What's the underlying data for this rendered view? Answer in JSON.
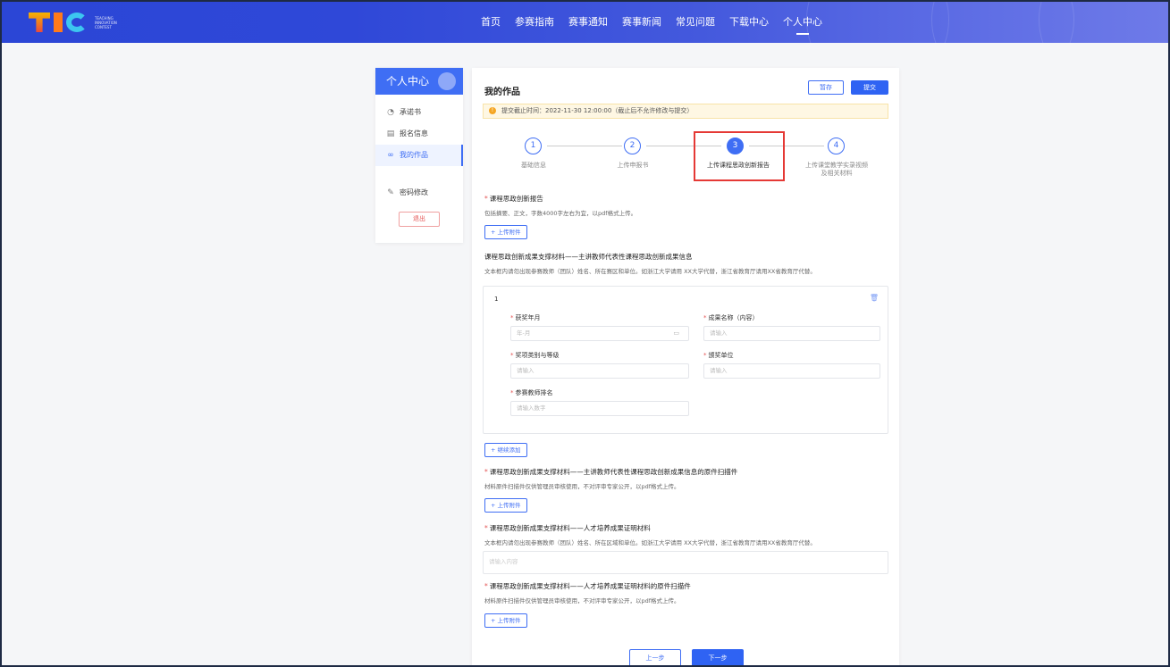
{
  "header": {
    "logo_text": "TEACHING INNOVATION CONTEST",
    "nav": [
      "首页",
      "参赛指南",
      "赛事通知",
      "赛事新闻",
      "常见问题",
      "下载中心",
      "个人中心"
    ],
    "active_nav_index": 6
  },
  "sidebar": {
    "title": "个人中心",
    "items": [
      {
        "label": "承诺书",
        "icon": "circle-icon"
      },
      {
        "label": "报名信息",
        "icon": "form-icon"
      },
      {
        "label": "我的作品",
        "icon": "link-icon",
        "active": true
      },
      {
        "label": "密码修改",
        "icon": "edit-icon"
      }
    ],
    "logout": "退出"
  },
  "main": {
    "title": "我的作品",
    "save_label": "暂存",
    "submit_label": "提交",
    "notice": "提交截止时间：2022-11-30 12:00:00（截止后不允许修改与提交）",
    "steps": [
      {
        "num": "1",
        "label": "基础信息"
      },
      {
        "num": "2",
        "label": "上传申报书"
      },
      {
        "num": "3",
        "label": "上传课程思政创新报告",
        "active": true
      },
      {
        "num": "4",
        "label": "上传课堂教学实录视频及相关材料"
      }
    ],
    "sec1": {
      "title": "课程思政创新报告",
      "desc": "包括摘要、正文，字数4000字左右为宜，以pdf格式上传。",
      "upload": "+ 上传附件"
    },
    "sec2": {
      "title": "课程思政创新成果支撑材料——主讲教师代表性课程思政创新成果信息",
      "desc": "文本框内请勿出现参赛教师（团队）姓名、所在赛区和单位。如浙江大学请用 XX大学代替，浙江省教育厅请用XX省教育厅代替。"
    },
    "panel": {
      "index": "1",
      "fields": {
        "award_date_label": "获奖年月",
        "award_date_placeholder": "年-月",
        "achievement_label": "成果名称（内容）",
        "achievement_placeholder": "请输入",
        "award_level_label": "奖项类别与等级",
        "award_level_placeholder": "请输入",
        "issuer_label": "颁奖单位",
        "issuer_placeholder": "请输入",
        "rank_label": "参赛教师排名",
        "rank_placeholder": "请输入数字"
      }
    },
    "add_label": "+ 继续添加",
    "sec3": {
      "title": "课程思政创新成果支撑材料——主讲教师代表性课程思政创新成果信息的原件扫描件",
      "desc": "材料原件扫描件仅供管理员审核使用，不对评审专家公开，以pdf格式上传。",
      "upload": "+ 上传附件"
    },
    "sec4": {
      "title": "课程思政创新成果支撑材料——人才培养成果证明材料",
      "desc": "文本框内请勿出现参赛教师（团队）姓名、所在区域和单位。如浙江大学请用 XX大学代替，浙江省教育厅请用XX省教育厅代替。",
      "placeholder": "请输入内容"
    },
    "sec5": {
      "title": "课程思政创新成果支撑材料——人才培养成果证明材料的原件扫描件",
      "desc": "材料原件扫描件仅供管理员审核使用，不对评审专家公开，以pdf格式上传。",
      "upload": "+ 上传附件"
    },
    "prev_label": "上一步",
    "next_label": "下一步"
  },
  "colors": {
    "primary": "#3f6ef4",
    "header_start": "#2b46d6",
    "header_end": "#6e7ae8",
    "highlight": "#e53935"
  }
}
